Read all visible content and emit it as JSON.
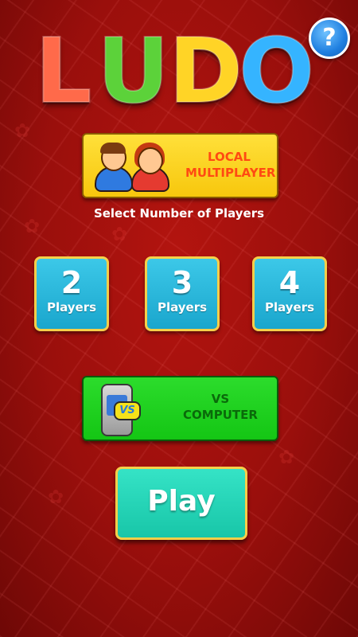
{
  "logo": {
    "letters": [
      "L",
      "U",
      "D",
      "O"
    ]
  },
  "help_button": {
    "label": "?"
  },
  "local_multiplayer": {
    "label": "LOCAL\nMULTIPLAYER"
  },
  "select_players": {
    "label": "Select Number of Players"
  },
  "player_options": [
    {
      "number": "2",
      "label": "Players"
    },
    {
      "number": "3",
      "label": "Players"
    },
    {
      "number": "4",
      "label": "Players"
    }
  ],
  "vs_computer": {
    "label": "VS\nCOMPUTER",
    "badge": "VS"
  },
  "play_button": {
    "label": "Play"
  },
  "colors": {
    "background": "#a8120d",
    "logo_l": "#ff6a4a",
    "logo_u": "#5cd23a",
    "logo_d": "#ffd426",
    "logo_o": "#35b4ff",
    "accent_yellow": "#f7c70d",
    "accent_green": "#14c614",
    "accent_teal": "#18c6a8"
  }
}
